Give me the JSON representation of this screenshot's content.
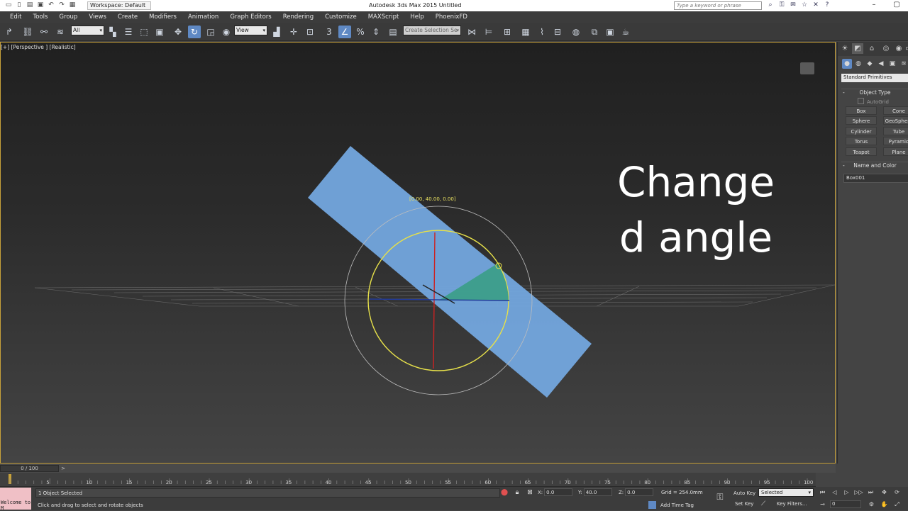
{
  "titlebar": {
    "workspace": "Workspace: Default",
    "title": "Autodesk 3ds Max  2015     Untitled",
    "search_placeholder": "Type a keyword or phrase"
  },
  "menu": [
    "Edit",
    "Tools",
    "Group",
    "Views",
    "Create",
    "Modifiers",
    "Animation",
    "Graph Editors",
    "Rendering",
    "Customize",
    "MAXScript",
    "Help",
    "PhoenixFD"
  ],
  "toolbar": {
    "filter": "All",
    "ref_coord": "View",
    "snap_label": "3",
    "named_sel": "Create Selection Se"
  },
  "viewport": {
    "label": "[+] [Perspective ] [Realistic]",
    "overlay_line1": "Change",
    "overlay_line2": "d angle",
    "rotate_readout": "[0.00, 40.00, 0.00]"
  },
  "command_panel": {
    "category": "Standard Primitives",
    "object_type_title": "Object Type",
    "autogrid": "AutoGrid",
    "buttons": [
      "Box",
      "Cone",
      "Sphere",
      "GeoSphere",
      "Cylinder",
      "Tube",
      "Torus",
      "Pyramid",
      "Teapot",
      "Plane"
    ],
    "name_color_title": "Name and Color",
    "object_name": "Box001"
  },
  "timeline": {
    "frame_display": "0 / 100",
    "ticks": [
      "5",
      "10",
      "15",
      "20",
      "25",
      "30",
      "35",
      "40",
      "45",
      "50",
      "55",
      "60",
      "65",
      "70",
      "75",
      "80",
      "85",
      "90",
      "95",
      "100"
    ]
  },
  "status": {
    "maxscript_text": "Welcome to M",
    "selection": "1 Object Selected",
    "prompt": "Click and drag to select and rotate objects",
    "x_label": "X:",
    "x_value": "0.0",
    "y_label": "Y:",
    "y_value": "40.0",
    "z_label": "Z:",
    "z_value": "0.0",
    "grid": "Grid = 254.0mm",
    "add_time_tag": "Add Time Tag",
    "auto_key": "Auto Key",
    "set_key": "Set Key",
    "key_mode": "Selected",
    "key_filters": "Key Filters...",
    "current_frame": "0"
  }
}
